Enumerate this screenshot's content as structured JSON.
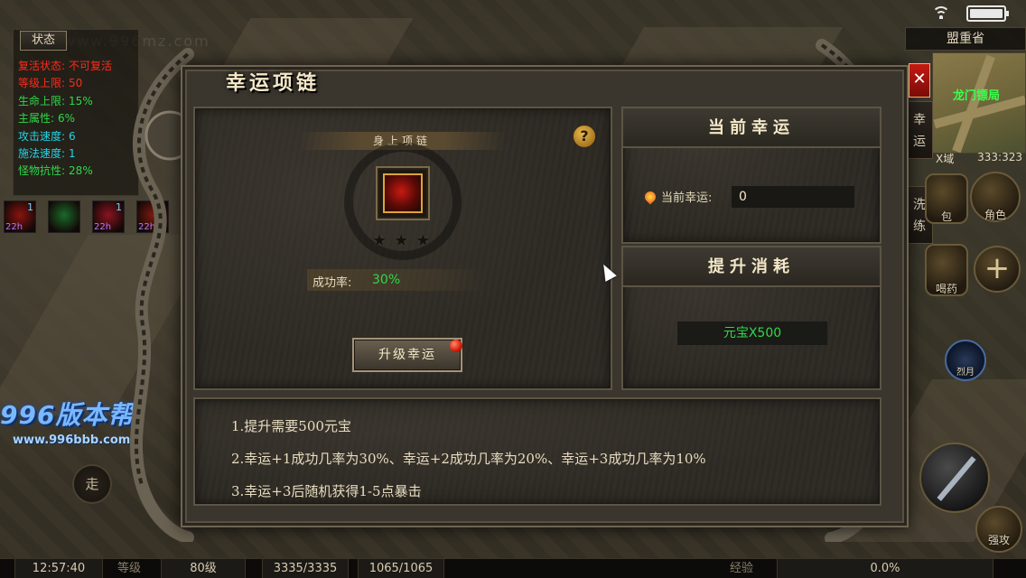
{
  "status_bar": {
    "wifi_icon": "wifi-icon",
    "battery_icon": "battery-icon"
  },
  "watermark": "www.996mz.com",
  "status_panel": {
    "tab_label": "状态",
    "stats": [
      {
        "label": "复活状态:",
        "value": "不可复活",
        "color": "#ff2a1a"
      },
      {
        "label": "等级上限:",
        "value": "50",
        "color": "#ff2a1a"
      },
      {
        "label": "生命上限:",
        "value": "15%",
        "color": "#2fd84a"
      },
      {
        "label": "主属性:",
        "value": "6%",
        "color": "#2fd84a"
      },
      {
        "label": "攻击速度:",
        "value": "6",
        "color": "#22d4e6"
      },
      {
        "label": "施法速度:",
        "value": "1",
        "color": "#22d4e6"
      },
      {
        "label": "怪物抗性:",
        "value": "28%",
        "color": "#2fd84a"
      }
    ]
  },
  "buffs": [
    {
      "count": "1",
      "time": "22h",
      "color": "#8a1410"
    },
    {
      "count": "",
      "time": "",
      "color": "#1a6a2a"
    },
    {
      "count": "1",
      "time": "22h",
      "color": "#8a1420"
    },
    {
      "count": "1",
      "time": "22h",
      "color": "#7a1a10"
    }
  ],
  "right_hud": {
    "location": "盟重省",
    "minimap_place": "龙门镖局",
    "region": "X域",
    "coords": "333:323",
    "side_tabs": [
      "幸运",
      "洗练"
    ],
    "bag_label": "包",
    "role_label": "角色",
    "potion_label": "喝药",
    "skill_label": "烈月",
    "attack_label": "强攻"
  },
  "logo": {
    "name": "996版本帮",
    "url": "www.996bbb.com"
  },
  "walk_label": "走",
  "dialog": {
    "title": "幸运项链",
    "close_label": "✕",
    "equip_title": "身上项链",
    "help_label": "?",
    "stars_total": 3,
    "success_rate_label": "成功率:",
    "success_rate_value": "30%",
    "upgrade_button": "升级幸运",
    "current_luck_header": "当前幸运",
    "current_luck_label": "当前幸运:",
    "current_luck_value": "0",
    "cost_header": "提升消耗",
    "cost_value": "元宝X500",
    "rules": [
      "1.提升需要500元宝",
      "2.幸运+1成功几率为30%、幸运+2成功几率为20%、幸运+3成功几率为10%",
      "3.幸运+3后随机获得1-5点暴击"
    ]
  },
  "bottom_bar": {
    "time": "12:57:40",
    "level_label": "等级",
    "level_value": "80级",
    "hp": "3335/3335",
    "mp": "1065/1065",
    "exp_label": "经验",
    "exp_value": "0.0%"
  }
}
